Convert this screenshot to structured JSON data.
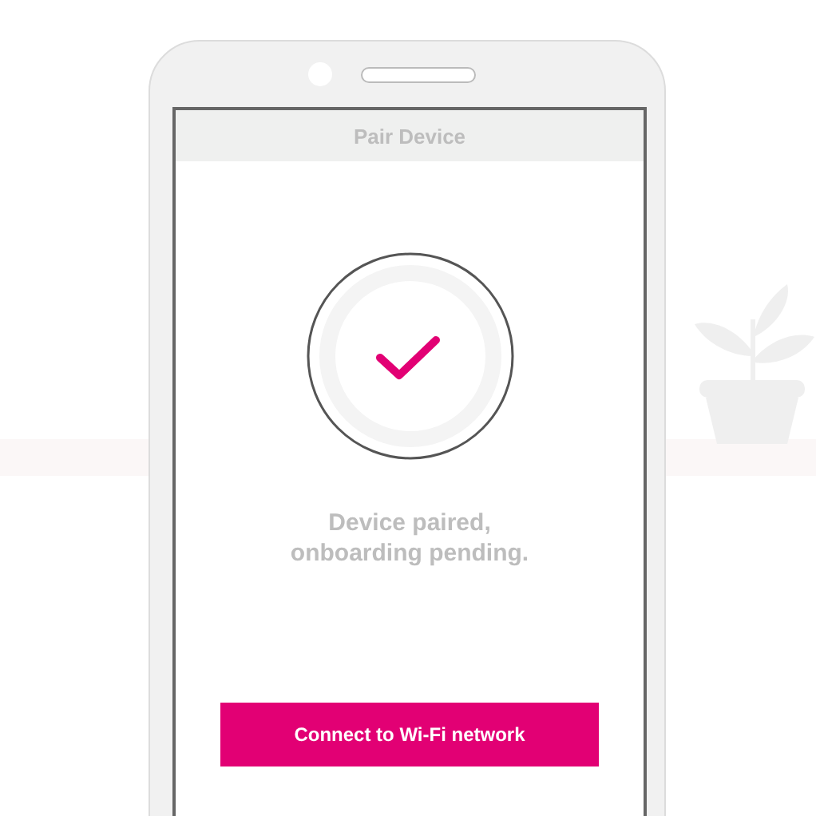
{
  "header": {
    "title": "Pair Device"
  },
  "status": {
    "message": "Device paired,\nonboarding pending."
  },
  "button": {
    "label": "Connect to Wi-Fi network"
  }
}
